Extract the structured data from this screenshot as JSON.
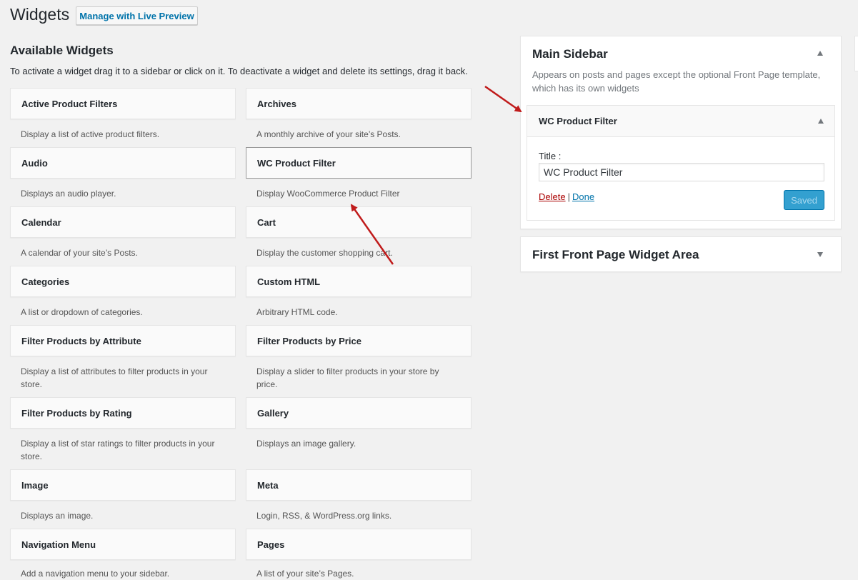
{
  "header": {
    "title": "Widgets",
    "live_preview_button": "Manage with Live Preview"
  },
  "available": {
    "title": "Available Widgets",
    "description": "To activate a widget drag it to a sidebar or click on it. To deactivate a widget and delete its settings, drag it back.",
    "widgets": [
      {
        "name": "Active Product Filters",
        "desc": "Display a list of active product filters."
      },
      {
        "name": "Archives",
        "desc": "A monthly archive of your site’s Posts."
      },
      {
        "name": "Audio",
        "desc": "Displays an audio player."
      },
      {
        "name": "WC Product Filter",
        "desc": "Display WooCommerce Product Filter"
      },
      {
        "name": "Calendar",
        "desc": "A calendar of your site’s Posts."
      },
      {
        "name": "Cart",
        "desc": "Display the customer shopping cart."
      },
      {
        "name": "Categories",
        "desc": "A list or dropdown of categories."
      },
      {
        "name": "Custom HTML",
        "desc": "Arbitrary HTML code."
      },
      {
        "name": "Filter Products by Attribute",
        "desc": "Display a list of attributes to filter products in your store."
      },
      {
        "name": "Filter Products by Price",
        "desc": "Display a slider to filter products in your store by price."
      },
      {
        "name": "Filter Products by Rating",
        "desc": "Display a list of star ratings to filter products in your store."
      },
      {
        "name": "Gallery",
        "desc": "Displays an image gallery."
      },
      {
        "name": "Image",
        "desc": "Displays an image."
      },
      {
        "name": "Meta",
        "desc": "Login, RSS, & WordPress.org links."
      },
      {
        "name": "Navigation Menu",
        "desc": "Add a navigation menu to your sidebar."
      },
      {
        "name": "Pages",
        "desc": "A list of your site’s Pages."
      }
    ]
  },
  "main_sidebar": {
    "title": "Main Sidebar",
    "description": "Appears on posts and pages except the optional Front Page template, which has its own widgets",
    "widget": {
      "title": "WC Product Filter",
      "field_label": "Title :",
      "field_value": "WC Product Filter",
      "delete_label": "Delete",
      "separator": "|",
      "done_label": "Done",
      "saved_label": "Saved"
    }
  },
  "second_sidebar": {
    "title": "First Front Page Widget Area"
  },
  "colors": {
    "accent": "#0073aa",
    "delete": "#a00000",
    "arrow": "#c01b1b",
    "saved_button": "#33a0d0"
  },
  "icons": {
    "collapse": "triangle-up-icon",
    "expand": "triangle-down-icon"
  }
}
